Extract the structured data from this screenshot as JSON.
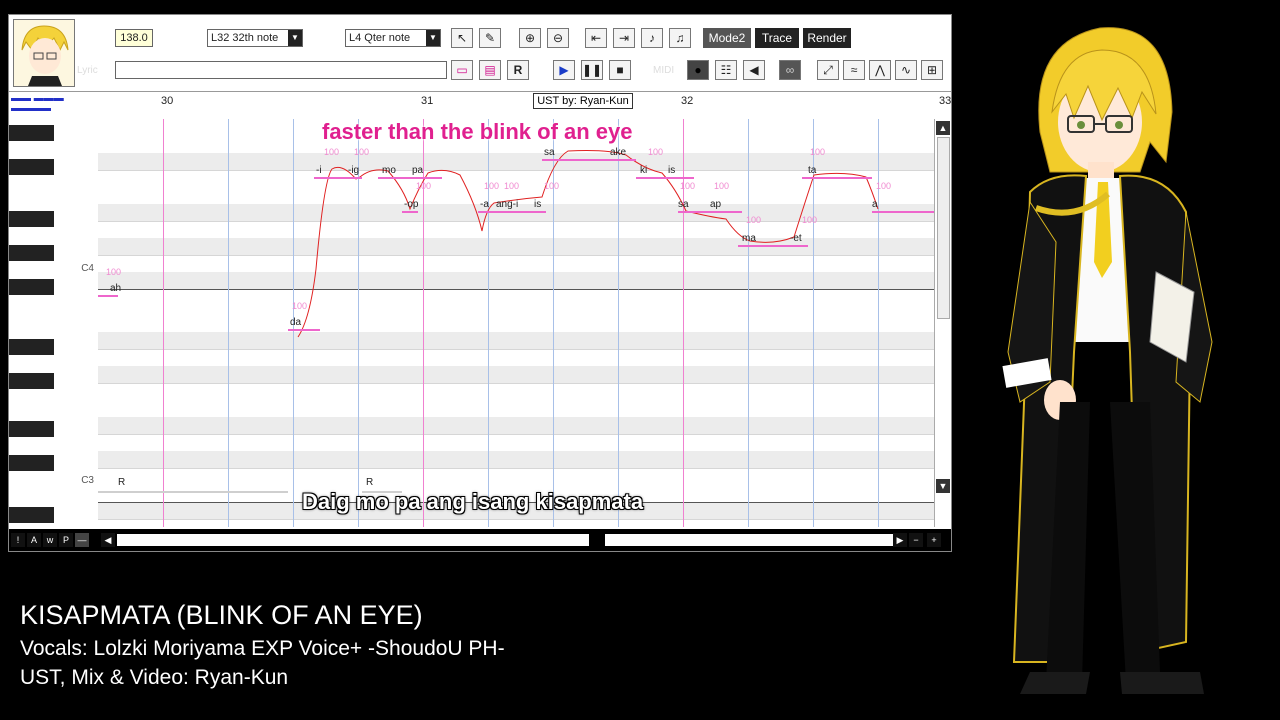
{
  "toolbar": {
    "tempo": "138.0",
    "quantize": "L32 32th note",
    "length": "L4  Qter note",
    "lyric_label": "Lyric",
    "lyric_value": "",
    "midi_label": "MIDI",
    "mode2": "Mode2",
    "trace": "Trace",
    "render": "Render"
  },
  "ruler": {
    "bars": [
      "30",
      "31",
      "32",
      "33"
    ],
    "ust_credit": "UST by: Ryan-Kun"
  },
  "piano": {
    "c4": "C4",
    "c3": "C3"
  },
  "notes": [
    {
      "lyric": "ah"
    },
    {
      "lyric": "da"
    },
    {
      "lyric": "-i"
    },
    {
      "lyric": "-ig"
    },
    {
      "lyric": "mo"
    },
    {
      "lyric": "pa"
    },
    {
      "lyric": "-op"
    },
    {
      "lyric": "-a"
    },
    {
      "lyric": "ang-i"
    },
    {
      "lyric": "is"
    },
    {
      "lyric": "sa"
    },
    {
      "lyric": "ake"
    },
    {
      "lyric": "ki"
    },
    {
      "lyric": "is"
    },
    {
      "lyric": "sa"
    },
    {
      "lyric": "ap"
    },
    {
      "lyric": "ma"
    },
    {
      "lyric": "-et"
    },
    {
      "lyric": "ta"
    },
    {
      "lyric": "a"
    },
    {
      "lyric": "R"
    },
    {
      "lyric": "R"
    }
  ],
  "velocity": "100",
  "subtitles": {
    "translation": "faster than the blink of an eye",
    "lyric": "Daig mo pa ang isang kisapmata"
  },
  "bottom_bar": {
    "buttons": [
      "!",
      "A",
      "w",
      "P",
      "—"
    ]
  },
  "credits": {
    "title": "KISAPMATA (BLINK OF AN EYE)",
    "vocals": "Vocals: Lolzki Moriyama EXP Voice+ -ShoudoU PH-",
    "ust": "UST, Mix & Video: Ryan-Kun"
  },
  "colors": {
    "pink": "#e0208f",
    "note": "#ee66cc",
    "bg": "#000000"
  }
}
